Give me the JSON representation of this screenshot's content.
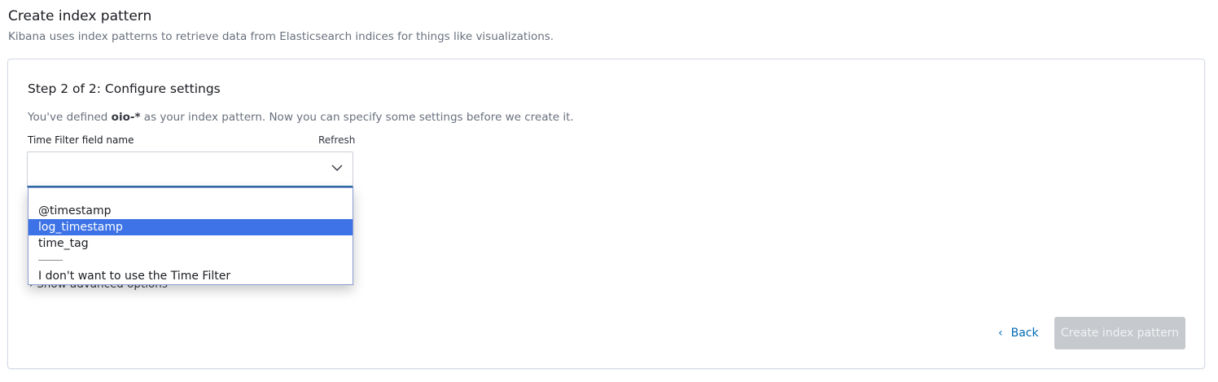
{
  "header": {
    "title": "Create index pattern",
    "subtitle": "Kibana uses index patterns to retrieve data from Elasticsearch indices for things like visualizations."
  },
  "step": {
    "title": "Step 2 of 2: Configure settings",
    "desc_prefix": "You've defined ",
    "pattern": "oio-*",
    "desc_suffix": " as your index pattern. Now you can specify some settings before we create it."
  },
  "time_field": {
    "label": "Time Filter field name",
    "refresh_label": "Refresh",
    "value": "",
    "options": [
      "@timestamp",
      "log_timestamp",
      "time_tag",
      "I don't want to use the Time Filter"
    ],
    "highlighted": "log_timestamp"
  },
  "advanced": {
    "label": "Show advanced options"
  },
  "actions": {
    "back_label": "Back",
    "create_label": "Create index pattern"
  },
  "colors": {
    "accent": "#006bb4",
    "highlight": "#3d73e6",
    "disabled": "#c6c9cd"
  }
}
